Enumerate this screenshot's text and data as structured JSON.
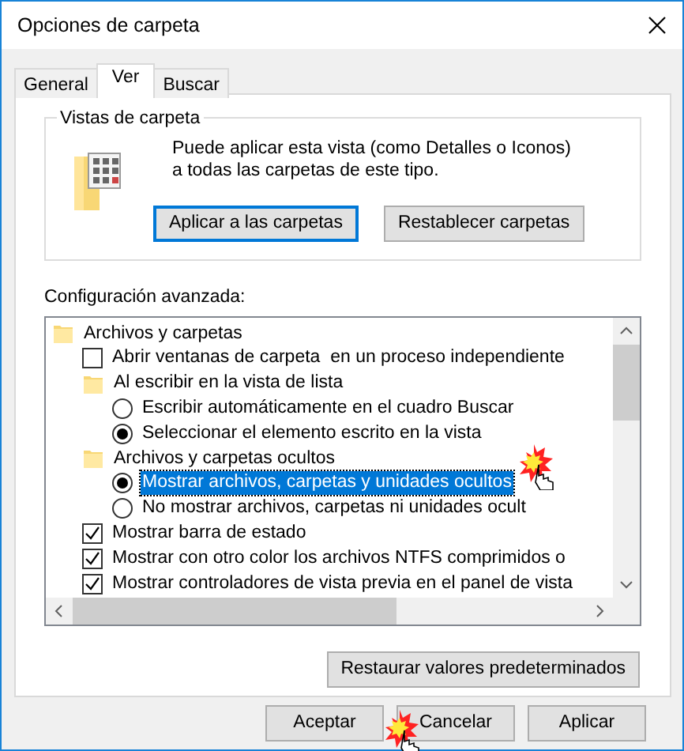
{
  "window": {
    "title": "Opciones de carpeta"
  },
  "tabs": [
    {
      "label": "General",
      "selected": false
    },
    {
      "label": "Ver",
      "selected": true
    },
    {
      "label": "Buscar",
      "selected": false
    }
  ],
  "folder_views": {
    "title": "Vistas de carpeta",
    "description": "Puede aplicar esta vista (como Detalles o Iconos) a todas las carpetas de este tipo.",
    "buttons": [
      {
        "label": "Aplicar a las carpetas",
        "focused": true
      },
      {
        "label": "Restablecer carpetas",
        "focused": false
      }
    ]
  },
  "advanced": {
    "label": "Configuración avanzada:",
    "items": [
      {
        "kind": "folder",
        "label": "Archivos y carpetas",
        "selected": false,
        "children": [
          {
            "kind": "checkbox",
            "label": "Abrir ventanas de carpeta  en un proceso independiente",
            "checked": false,
            "selected": false
          },
          {
            "kind": "folder",
            "label": "Al escribir en la vista de lista",
            "selected": false,
            "children": [
              {
                "kind": "radio",
                "label": "Escribir automáticamente en el cuadro Buscar",
                "checked": false,
                "selected": false
              },
              {
                "kind": "radio",
                "label": "Seleccionar el elemento escrito en la vista",
                "checked": true,
                "selected": false
              }
            ]
          },
          {
            "kind": "folder",
            "label": "Archivos y carpetas ocultos",
            "selected": false,
            "children": [
              {
                "kind": "radio",
                "label": "Mostrar archivos, carpetas y unidades ocultos",
                "checked": true,
                "selected": true
              },
              {
                "kind": "radio",
                "label": "No mostrar archivos, carpetas ni unidades ocult",
                "checked": false,
                "selected": false
              }
            ]
          },
          {
            "kind": "checkbox",
            "label": "Mostrar barra de estado",
            "checked": true,
            "selected": false
          },
          {
            "kind": "checkbox",
            "label": "Mostrar con otro color los archivos NTFS comprimidos o",
            "checked": true,
            "selected": false
          },
          {
            "kind": "checkbox",
            "label": "Mostrar controladores de vista previa en el panel de vista",
            "checked": true,
            "selected": false
          }
        ]
      }
    ],
    "restore_button": "Restaurar valores predeterminados"
  },
  "buttons": [
    {
      "label": "Aceptar"
    },
    {
      "label": "Cancelar"
    },
    {
      "label": "Aplicar"
    }
  ]
}
